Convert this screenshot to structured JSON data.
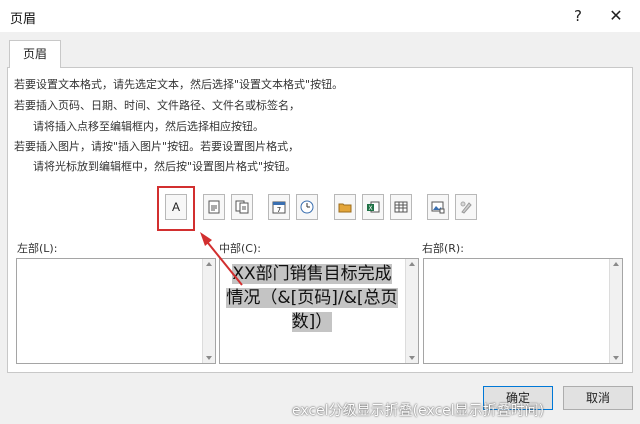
{
  "window": {
    "title": "页眉",
    "help_label": "?",
    "close_label": "✕"
  },
  "tab": {
    "label": "页眉"
  },
  "instructions": [
    "若要设置文本格式，请先选定文本，然后选择\"设置文本格式\"按钮。",
    "若要插入页码、日期、时间、文件路径、文件名或标签名，",
    "请将插入点移至编辑框内，然后选择相应按钮。",
    "若要插入图片，请按\"插入图片\"按钮。若要设置图片格式，",
    "请将光标放到编辑框中，然后按\"设置图片格式\"按钮。"
  ],
  "toolbar": {
    "format_text_label": "A",
    "icons": [
      "format-text-icon",
      "page-number-icon",
      "page-count-icon",
      "date-icon",
      "time-icon",
      "file-path-icon",
      "file-name-icon",
      "sheet-name-icon",
      "insert-picture-icon",
      "format-picture-icon"
    ]
  },
  "sections": {
    "left_label": "左部(L):",
    "center_label": "中部(C):",
    "right_label": "右部(R):",
    "center_text": "XX部门销售目标完成情况（&[页码]/&[总页数]）"
  },
  "buttons": {
    "ok": "确定",
    "cancel": "取消"
  },
  "watermark": "excel分级显示折叠(excel显示折叠时间)",
  "colors": {
    "highlight": "#d22f2f",
    "selection": "#c4c4c4",
    "excel_green": "#1e7145",
    "folder": "#e3a53a"
  }
}
